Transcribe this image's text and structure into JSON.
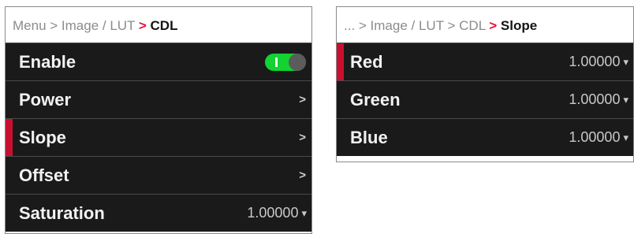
{
  "left_panel": {
    "breadcrumb": {
      "path": "Menu > Image / LUT",
      "separator": ">",
      "current": "CDL"
    },
    "items": [
      {
        "label": "Enable",
        "control": "toggle",
        "toggle_on": true
      },
      {
        "label": "Power",
        "chevron": ">"
      },
      {
        "label": "Slope",
        "chevron": ">",
        "selected": true
      },
      {
        "label": "Offset",
        "chevron": ">"
      },
      {
        "label": "Saturation",
        "value": "1.00000",
        "caret": "▾"
      }
    ]
  },
  "right_panel": {
    "breadcrumb": {
      "path": "... > Image / LUT > CDL",
      "separator": ">",
      "current": "Slope"
    },
    "items": [
      {
        "label": "Red",
        "value": "1.00000",
        "caret": "▾",
        "selected": true
      },
      {
        "label": "Green",
        "value": "1.00000",
        "caret": "▾"
      },
      {
        "label": "Blue",
        "value": "1.00000",
        "caret": "▾"
      }
    ]
  },
  "colors": {
    "accent_red": "#e5133a",
    "selection_bar": "#c8102e",
    "toggle_on": "#12d331",
    "row_background": "#1a1a1a"
  }
}
